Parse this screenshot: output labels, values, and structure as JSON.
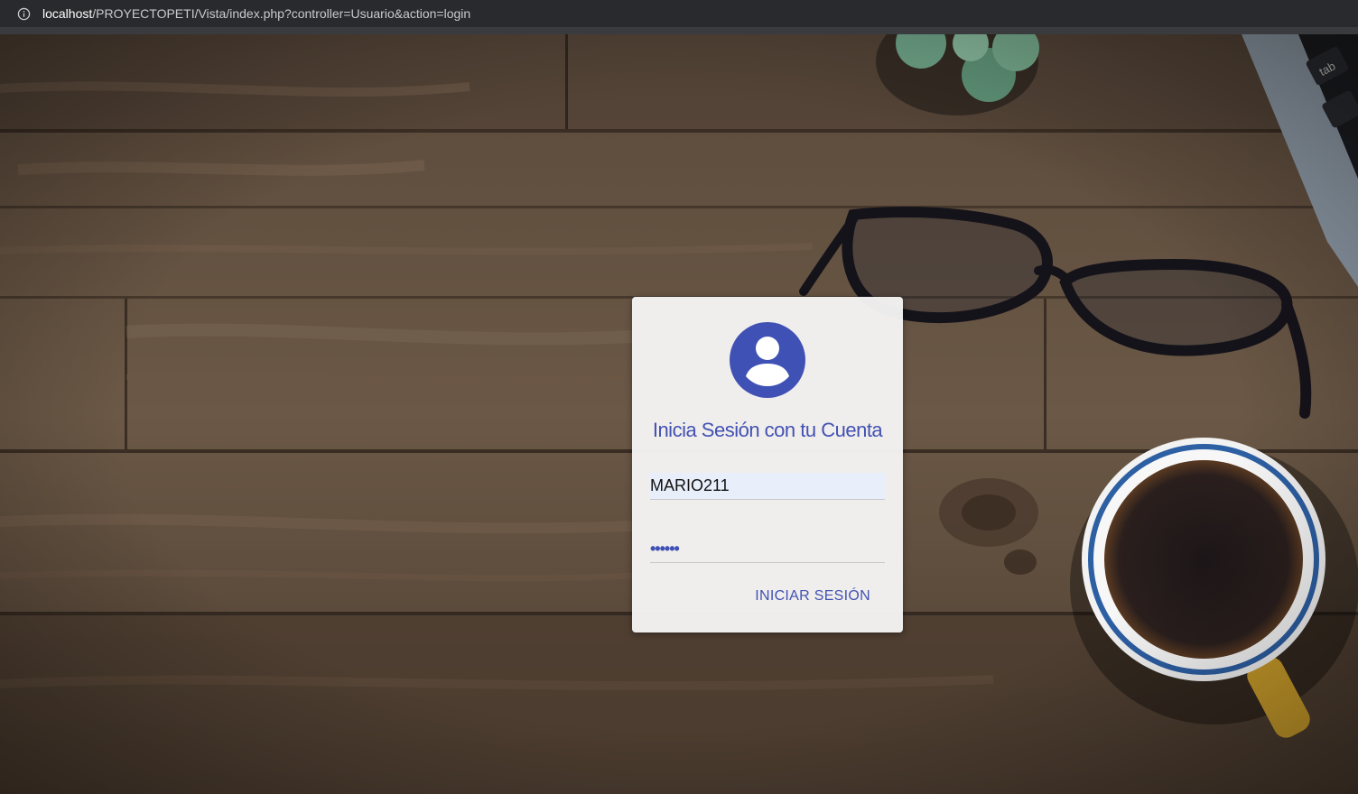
{
  "browser": {
    "url_host": "localhost",
    "url_path": "/PROYECTOPETI/Vista/index.php?controller=Usuario&action=login",
    "info_icon": "info-icon"
  },
  "background": {
    "description_icons": [
      "plant",
      "glasses",
      "coffee-cup",
      "laptop"
    ]
  },
  "login": {
    "avatar_icon": "account-circle-icon",
    "title": "Inicia Sesión con tu Cuenta",
    "username_value": "MARIO211",
    "password_mask": "••••••",
    "submit_label": "INICIAR SESIÓN",
    "accent_color": "#3f51b5"
  },
  "desk_keyboard_label": "tab"
}
